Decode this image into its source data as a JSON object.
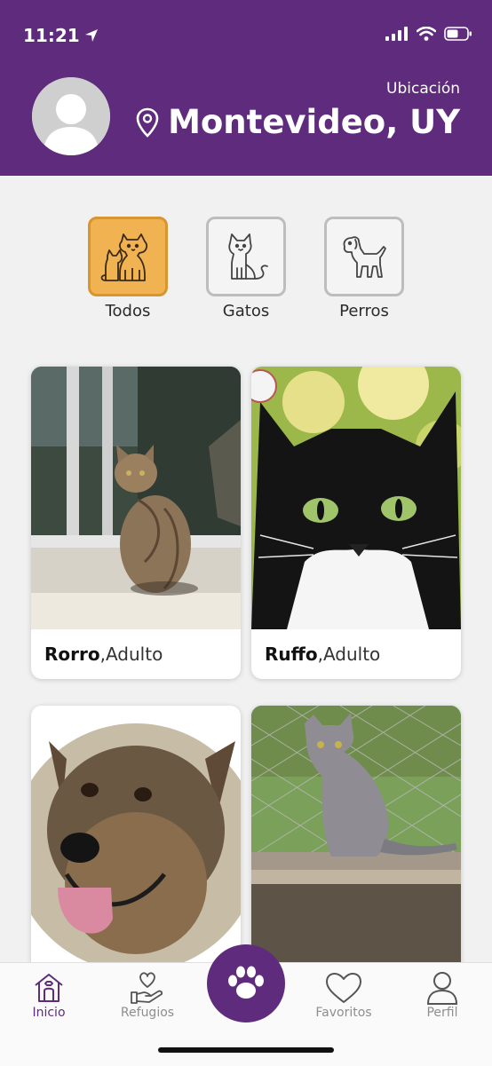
{
  "status_bar": {
    "time": "11:21"
  },
  "header": {
    "location_label": "Ubicación",
    "location_value": "Montevideo, UY"
  },
  "filters": [
    {
      "label": "Todos",
      "icon": "cat-and-dog-icon",
      "active": true
    },
    {
      "label": "Gatos",
      "icon": "cat-icon",
      "active": false
    },
    {
      "label": "Perros",
      "icon": "dog-icon",
      "active": false
    }
  ],
  "pets": [
    {
      "name": "Rorro",
      "age": "Adulto",
      "photo": "tabby cat sitting on a ledge"
    },
    {
      "name": "Ruffo",
      "age": "Adulto",
      "photo": "black and white cat close-up"
    },
    {
      "name": "",
      "age": "",
      "photo": "smiling dog with tongue out"
    },
    {
      "name": "",
      "age": "",
      "photo": "gray cat sitting on a wall"
    }
  ],
  "pet_separator": ", ",
  "tabbar": {
    "items": [
      {
        "label": "Inicio",
        "icon": "home-icon",
        "active": true
      },
      {
        "label": "Refugios",
        "icon": "heart-in-hand-icon",
        "active": false
      },
      {
        "label": "",
        "icon": "paw-icon",
        "active": false
      },
      {
        "label": "Favoritos",
        "icon": "heart-icon",
        "active": false
      },
      {
        "label": "Perfil",
        "icon": "user-icon",
        "active": false
      }
    ]
  },
  "colors": {
    "brand": "#5f2b7c",
    "filter_active": "#f1b251",
    "background": "#f1f1f1"
  }
}
